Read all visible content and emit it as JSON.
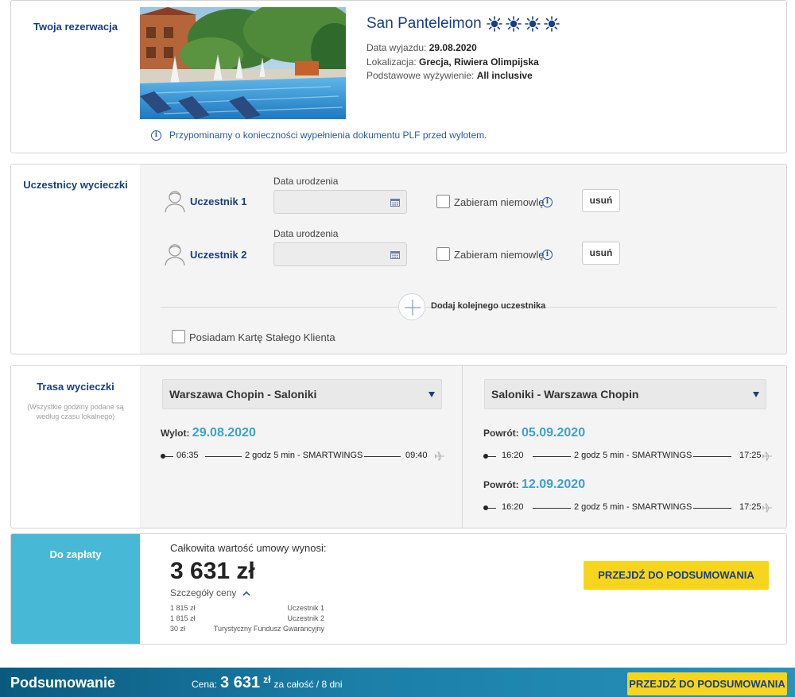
{
  "reservation": {
    "section_title": "Twoja rezerwacja",
    "hotel_name": "San Panteleimon",
    "stars": 4,
    "departure_label": "Data wyjazdu:",
    "departure_value": "29.08.2020",
    "location_label": "Lokalizacja:",
    "location_value": "Grecja, Riwiera Olimpijska",
    "board_label": "Podstawowe wyżywienie:",
    "board_value": "All inclusive",
    "notice": "Przypominamy o konieczności wypełnienia dokumentu PLF przed wylotem."
  },
  "participants": {
    "section_title": "Uczestnicy wycieczki",
    "items": [
      {
        "name": "Uczestnik 1",
        "dob_label": "Data urodzenia",
        "dob_value": "",
        "infant_label": "Zabieram niemowlę",
        "remove_label": "usuń"
      },
      {
        "name": "Uczestnik 2",
        "dob_label": "Data urodzenia",
        "dob_value": "",
        "infant_label": "Zabieram niemowlę",
        "remove_label": "usuń"
      }
    ],
    "add_label": "Dodaj kolejnego uczestnika",
    "loyalty_label": "Posiadam Kartę Stałego Klienta"
  },
  "route": {
    "section_title": "Trasa wycieczki",
    "section_note": "(Wszystkie godziny podane są według czasu lokalnego)",
    "outbound": {
      "select": "Warszawa Chopin - Saloniki",
      "flights": [
        {
          "label": "Wylot:",
          "date": "29.08.2020",
          "dep": "06:35",
          "duration": "2 godz 5 min",
          "carrier": "SMARTWINGS",
          "arr": "09:40"
        }
      ]
    },
    "return": {
      "select": "Saloniki - Warszawa Chopin",
      "flights": [
        {
          "label": "Powrót:",
          "date": "05.09.2020",
          "dep": "16:20",
          "duration": "2 godz 5 min",
          "carrier": "SMARTWINGS",
          "arr": "17:25"
        },
        {
          "label": "Powrót:",
          "date": "12.09.2020",
          "dep": "16:20",
          "duration": "2 godz 5 min",
          "carrier": "SMARTWINGS",
          "arr": "17:25"
        }
      ]
    }
  },
  "payment": {
    "section_title": "Do zapłaty",
    "total_label": "Całkowita wartość umowy wynosi:",
    "total_value": "3 631 zł",
    "details_label": "Szczegóły ceny",
    "rows": [
      {
        "amount": "1 815 zł",
        "desc": "Uczestnik 1"
      },
      {
        "amount": "1 815 zł",
        "desc": "Uczestnik 2"
      },
      {
        "amount": "30 zł",
        "desc": "Turystyczny Fundusz Gwarancyjny"
      }
    ],
    "cta": "PRZEJDŹ DO PODSUMOWANIA"
  },
  "summary_bar": {
    "title": "Podsumowanie",
    "price_label": "Cena:",
    "price_value": "3 631",
    "currency": "zł",
    "price_suffix": "za całość / 8 dni",
    "cta": "PRZEJDŹ DO PODSUMOWANIA"
  },
  "colors": {
    "navy": "#1a3e7e",
    "accent_blue": "#3ba2cc",
    "payment_side": "#47b9d6",
    "cta_yellow": "#f7d51d"
  }
}
